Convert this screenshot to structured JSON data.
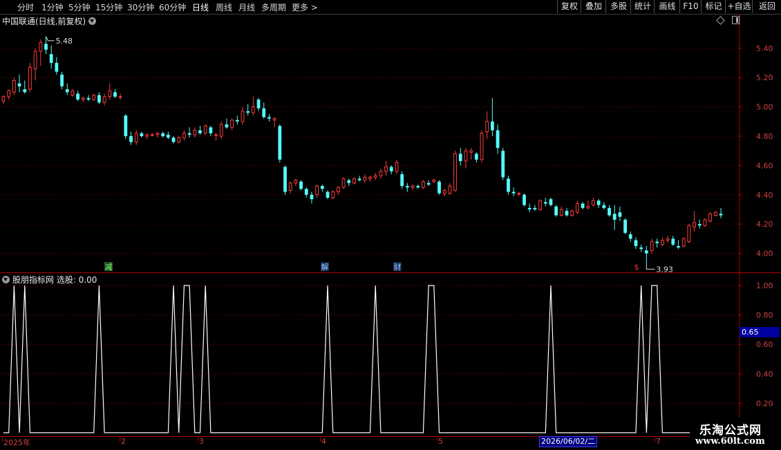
{
  "toolbar": {
    "periods": [
      "分时",
      "1分钟",
      "5分钟",
      "15分钟",
      "30分钟",
      "60分钟",
      "日线",
      "周线",
      "月线",
      "多周期",
      "更多 >"
    ],
    "active_period": "日线",
    "buttons": [
      "复权",
      "叠加",
      "多股",
      "统计",
      "画线",
      "F10",
      "标记",
      "+自选",
      "返回"
    ]
  },
  "main_panel": {
    "title": "中国联通(日线,前复权)",
    "high_marker": "5.48",
    "low_marker": "3.93",
    "event_markers": [
      "减",
      "解",
      "财",
      "$"
    ]
  },
  "indicator_panel": {
    "title": "股朋指标网 选股: 0.00",
    "value_box": "0.65"
  },
  "time_axis": {
    "labels": [
      "2025年",
      "2",
      "3",
      "4",
      "5",
      "6",
      "7"
    ],
    "cursor_date": "2026/06/02/二"
  },
  "watermark": {
    "line1": "乐淘公式网",
    "line2": "www.60lt.com"
  },
  "colors": {
    "up": "#ff3c3c",
    "down": "#54ffff",
    "grid": "#8b0000",
    "axis_text": "#d04040",
    "indicator_line": "#ffffff"
  },
  "chart_data": [
    {
      "type": "candlestick",
      "title": "中国联通(日线,前复权)",
      "ylim": [
        3.88,
        5.55
      ],
      "y_ticks": [
        4.0,
        4.2,
        4.4,
        4.6,
        4.8,
        5.0,
        5.2,
        5.4
      ],
      "candles": [
        [
          5.04,
          5.08,
          5.02,
          5.07
        ],
        [
          5.07,
          5.12,
          5.05,
          5.11
        ],
        [
          5.1,
          5.2,
          5.08,
          5.18
        ],
        [
          5.16,
          5.22,
          5.1,
          5.14
        ],
        [
          5.12,
          5.18,
          5.09,
          5.1
        ],
        [
          5.12,
          5.3,
          5.1,
          5.27
        ],
        [
          5.26,
          5.4,
          5.18,
          5.38
        ],
        [
          5.38,
          5.46,
          5.28,
          5.44
        ],
        [
          5.43,
          5.48,
          5.36,
          5.39
        ],
        [
          5.36,
          5.42,
          5.26,
          5.3
        ],
        [
          5.3,
          5.34,
          5.22,
          5.24
        ],
        [
          5.22,
          5.24,
          5.12,
          5.14
        ],
        [
          5.12,
          5.16,
          5.08,
          5.1
        ],
        [
          5.08,
          5.12,
          5.07,
          5.11
        ],
        [
          5.09,
          5.11,
          5.04,
          5.05
        ],
        [
          5.05,
          5.07,
          5.03,
          5.06
        ],
        [
          5.06,
          5.08,
          5.04,
          5.05
        ],
        [
          5.05,
          5.09,
          5.04,
          5.08
        ],
        [
          5.08,
          5.1,
          5.02,
          5.03
        ],
        [
          5.03,
          5.09,
          5.01,
          5.07
        ],
        [
          5.07,
          5.16,
          5.05,
          5.11
        ],
        [
          5.1,
          5.12,
          5.06,
          5.07
        ],
        [
          5.07,
          5.09,
          5.05,
          5.07
        ],
        [
          4.94,
          4.95,
          4.78,
          4.8
        ],
        [
          4.8,
          4.83,
          4.74,
          4.76
        ],
        [
          4.76,
          4.84,
          4.74,
          4.82
        ],
        [
          4.82,
          4.83,
          4.79,
          4.8
        ],
        [
          4.8,
          4.82,
          4.78,
          4.81
        ],
        [
          4.81,
          4.82,
          4.8,
          4.81
        ],
        [
          4.81,
          4.83,
          4.79,
          4.82
        ],
        [
          4.82,
          4.83,
          4.79,
          4.8
        ],
        [
          4.81,
          4.83,
          4.78,
          4.79
        ],
        [
          4.79,
          4.8,
          4.75,
          4.76
        ],
        [
          4.76,
          4.8,
          4.75,
          4.79
        ],
        [
          4.79,
          4.84,
          4.77,
          4.82
        ],
        [
          4.82,
          4.86,
          4.79,
          4.81
        ],
        [
          4.81,
          4.86,
          4.79,
          4.84
        ],
        [
          4.84,
          4.87,
          4.81,
          4.82
        ],
        [
          4.82,
          4.88,
          4.81,
          4.87
        ],
        [
          4.86,
          4.87,
          4.8,
          4.82
        ],
        [
          4.81,
          4.82,
          4.77,
          4.81
        ],
        [
          4.8,
          4.9,
          4.78,
          4.88
        ],
        [
          4.88,
          4.92,
          4.85,
          4.86
        ],
        [
          4.86,
          4.92,
          4.84,
          4.91
        ],
        [
          4.91,
          4.94,
          4.88,
          4.9
        ],
        [
          4.9,
          5.0,
          4.88,
          4.97
        ],
        [
          4.97,
          5.02,
          4.94,
          4.96
        ],
        [
          4.96,
          5.07,
          4.94,
          5.0
        ],
        [
          5.05,
          5.06,
          4.97,
          4.99
        ],
        [
          4.99,
          5.03,
          4.92,
          4.93
        ],
        [
          4.93,
          4.95,
          4.9,
          4.92
        ],
        [
          4.91,
          4.93,
          4.86,
          4.92
        ],
        [
          4.87,
          4.88,
          4.62,
          4.64
        ],
        [
          4.59,
          4.6,
          4.4,
          4.42
        ],
        [
          4.43,
          4.49,
          4.41,
          4.48
        ],
        [
          4.48,
          4.51,
          4.46,
          4.5
        ],
        [
          4.49,
          4.5,
          4.43,
          4.44
        ],
        [
          4.44,
          4.45,
          4.38,
          4.4
        ],
        [
          4.4,
          4.42,
          4.34,
          4.37
        ],
        [
          4.4,
          4.47,
          4.38,
          4.46
        ],
        [
          4.46,
          4.47,
          4.42,
          4.44
        ],
        [
          4.42,
          4.43,
          4.37,
          4.38
        ],
        [
          4.38,
          4.43,
          4.37,
          4.42
        ],
        [
          4.42,
          4.46,
          4.4,
          4.45
        ],
        [
          4.45,
          4.52,
          4.44,
          4.51
        ],
        [
          4.5,
          4.51,
          4.46,
          4.48
        ],
        [
          4.48,
          4.52,
          4.47,
          4.51
        ],
        [
          4.51,
          4.53,
          4.49,
          4.5
        ],
        [
          4.5,
          4.54,
          4.48,
          4.52
        ],
        [
          4.51,
          4.53,
          4.49,
          4.52
        ],
        [
          4.52,
          4.55,
          4.5,
          4.53
        ],
        [
          4.53,
          4.58,
          4.51,
          4.56
        ],
        [
          4.56,
          4.63,
          4.53,
          4.59
        ],
        [
          4.59,
          4.6,
          4.54,
          4.56
        ],
        [
          4.56,
          4.64,
          4.54,
          4.62
        ],
        [
          4.54,
          4.56,
          4.44,
          4.46
        ],
        [
          4.46,
          4.48,
          4.42,
          4.45
        ],
        [
          4.45,
          4.47,
          4.43,
          4.46
        ],
        [
          4.46,
          4.47,
          4.44,
          4.45
        ],
        [
          4.45,
          4.5,
          4.44,
          4.49
        ],
        [
          4.48,
          4.5,
          4.46,
          4.47
        ],
        [
          4.49,
          4.51,
          4.48,
          4.5
        ],
        [
          4.49,
          4.5,
          4.4,
          4.41
        ],
        [
          4.41,
          4.44,
          4.39,
          4.43
        ],
        [
          4.41,
          4.48,
          4.4,
          4.46
        ],
        [
          4.43,
          4.7,
          4.42,
          4.68
        ],
        [
          4.68,
          4.72,
          4.6,
          4.63
        ],
        [
          4.63,
          4.72,
          4.58,
          4.7
        ],
        [
          4.69,
          4.72,
          4.64,
          4.7
        ],
        [
          4.68,
          4.69,
          4.62,
          4.64
        ],
        [
          4.64,
          4.84,
          4.62,
          4.82
        ],
        [
          4.83,
          4.97,
          4.78,
          4.9
        ],
        [
          4.9,
          5.06,
          4.8,
          4.84
        ],
        [
          4.84,
          4.88,
          4.68,
          4.72
        ],
        [
          4.7,
          4.72,
          4.5,
          4.52
        ],
        [
          4.51,
          4.53,
          4.4,
          4.42
        ],
        [
          4.42,
          4.45,
          4.39,
          4.41
        ],
        [
          4.41,
          4.42,
          4.39,
          4.41
        ],
        [
          4.4,
          4.41,
          4.32,
          4.33
        ],
        [
          4.31,
          4.34,
          4.28,
          4.3
        ],
        [
          4.31,
          4.33,
          4.29,
          4.3
        ],
        [
          4.3,
          4.37,
          4.29,
          4.36
        ],
        [
          4.35,
          4.38,
          4.32,
          4.34
        ],
        [
          4.37,
          4.38,
          4.32,
          4.33
        ],
        [
          4.32,
          4.33,
          4.25,
          4.26
        ],
        [
          4.26,
          4.32,
          4.25,
          4.3
        ],
        [
          4.29,
          4.31,
          4.25,
          4.26
        ],
        [
          4.26,
          4.3,
          4.25,
          4.29
        ],
        [
          4.28,
          4.36,
          4.27,
          4.34
        ],
        [
          4.34,
          4.35,
          4.3,
          4.31
        ],
        [
          4.31,
          4.36,
          4.3,
          4.32
        ],
        [
          4.33,
          4.38,
          4.32,
          4.36
        ],
        [
          4.36,
          4.37,
          4.31,
          4.33
        ],
        [
          4.33,
          4.35,
          4.3,
          4.31
        ],
        [
          4.31,
          4.33,
          4.25,
          4.26
        ],
        [
          4.27,
          4.33,
          4.16,
          4.23
        ],
        [
          4.28,
          4.32,
          4.22,
          4.25
        ],
        [
          4.23,
          4.24,
          4.13,
          4.14
        ],
        [
          4.13,
          4.15,
          4.08,
          4.1
        ],
        [
          4.09,
          4.11,
          4.03,
          4.05
        ],
        [
          4.04,
          4.06,
          4.01,
          4.03
        ],
        [
          4.02,
          4.05,
          3.93,
          4.0
        ],
        [
          4.02,
          4.1,
          4.0,
          4.08
        ],
        [
          4.08,
          4.1,
          4.04,
          4.07
        ],
        [
          4.06,
          4.11,
          4.05,
          4.09
        ],
        [
          4.09,
          4.12,
          4.07,
          4.1
        ],
        [
          4.1,
          4.12,
          4.05,
          4.06
        ],
        [
          4.05,
          4.09,
          4.03,
          4.04
        ],
        [
          4.05,
          4.11,
          4.04,
          4.1
        ],
        [
          4.08,
          4.2,
          4.07,
          4.19
        ],
        [
          4.18,
          4.29,
          4.15,
          4.21
        ],
        [
          4.2,
          4.23,
          4.17,
          4.19
        ],
        [
          4.19,
          4.24,
          4.18,
          4.23
        ],
        [
          4.22,
          4.28,
          4.21,
          4.27
        ],
        [
          4.26,
          4.29,
          4.25,
          4.28
        ],
        [
          4.27,
          4.31,
          4.24,
          4.26
        ]
      ]
    },
    {
      "type": "line",
      "title": "股朋指标网 选股: 0.00",
      "ylim": [
        0,
        1.0
      ],
      "y_ticks": [
        0.2,
        0.4,
        0.6,
        0.8,
        1.0
      ],
      "signal_indices": [
        2,
        4,
        18,
        32,
        34,
        35,
        38,
        61,
        70,
        80,
        81,
        103,
        120,
        122,
        123
      ]
    }
  ]
}
